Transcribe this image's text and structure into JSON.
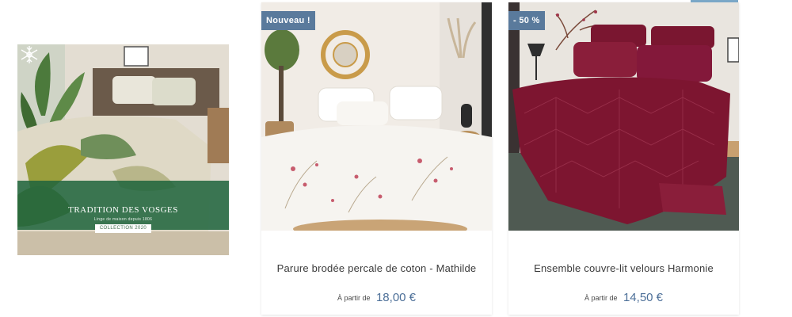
{
  "banner": {
    "brand": "TRADITION DES VOSGES",
    "tagline": "Linge de maison depuis 1806",
    "collection": "COLLECTION 2020",
    "logo_icon": "snowflake-icon"
  },
  "products": [
    {
      "badge": "Nouveau !",
      "title": "Parure brodée percale de coton - Mathilde",
      "price_prefix": "À partir de",
      "price": "18,00 €"
    },
    {
      "badge": "- 50 %",
      "title": "Ensemble couvre-lit velours Harmonie",
      "price_prefix": "À partir de",
      "price": "14,50 €"
    }
  ],
  "colors": {
    "brand_green": "#1e643c",
    "badge_blue": "#5a7a9c",
    "price_blue": "#4c6f98",
    "bordeaux": "#7a1630"
  }
}
